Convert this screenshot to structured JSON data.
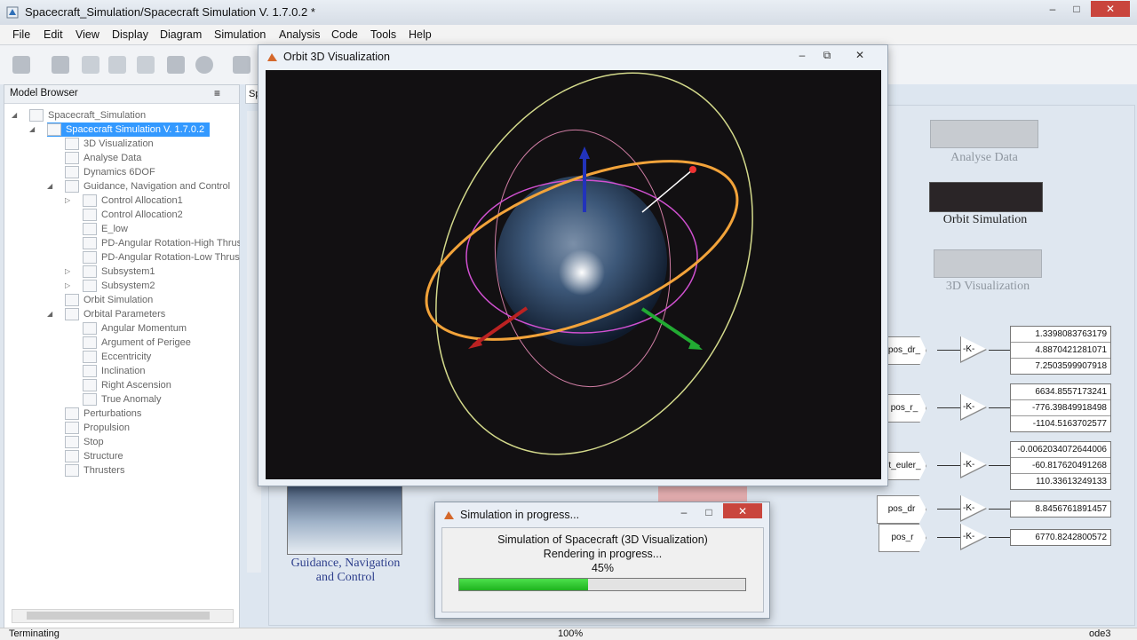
{
  "window": {
    "title": "Spacecraft_Simulation/Spacecraft Simulation V. 1.7.0.2 *",
    "controls": {
      "minimize": "–",
      "maximize": "□",
      "close": "✕"
    }
  },
  "menu": [
    "File",
    "Edit",
    "View",
    "Display",
    "Diagram",
    "Simulation",
    "Analysis",
    "Code",
    "Tools",
    "Help"
  ],
  "model_browser": {
    "title": "Model Browser",
    "menu_icon": "≡",
    "tree": [
      {
        "label": "Spacecraft_Simulation",
        "expander": "◢"
      },
      {
        "label": "Spacecraft Simulation V. 1.7.0.2",
        "expander": "◢",
        "selected": true
      },
      {
        "label": "3D Visualization"
      },
      {
        "label": "Analyse Data"
      },
      {
        "label": "Dynamics 6DOF"
      },
      {
        "label": "Guidance, Navigation and Control",
        "expander": "◢"
      },
      {
        "label": "Control Allocation1",
        "expander": "▷"
      },
      {
        "label": "Control Allocation2"
      },
      {
        "label": "E_low"
      },
      {
        "label": "PD-Angular Rotation-High Thrus"
      },
      {
        "label": "PD-Angular Rotation-Low Thrus"
      },
      {
        "label": "Subsystem1",
        "expander": "▷"
      },
      {
        "label": "Subsystem2",
        "expander": "▷"
      },
      {
        "label": "Orbit Simulation"
      },
      {
        "label": "Orbital Parameters",
        "expander": "◢"
      },
      {
        "label": "Angular Momentum"
      },
      {
        "label": "Argument of Perigee"
      },
      {
        "label": "Eccentricity"
      },
      {
        "label": "Inclination"
      },
      {
        "label": "Right Ascension"
      },
      {
        "label": "True Anomaly"
      },
      {
        "label": "Perturbations"
      },
      {
        "label": "Propulsion"
      },
      {
        "label": "Stop"
      },
      {
        "label": "Structure"
      },
      {
        "label": "Thrusters"
      }
    ]
  },
  "diagram": {
    "tab_label": "Sp",
    "blocks": {
      "analyse": "Analyse Data",
      "orbit": "Orbit Simulation",
      "viz": "3D Visualization",
      "gnc": "Guidance, Navigation\nand Control"
    },
    "gain_label": "-K-",
    "signals": [
      {
        "inport": "pos_dr_",
        "values": [
          "1.3398083763179",
          "4.8870421281071",
          "7.2503599907918"
        ]
      },
      {
        "inport": "pos_r_",
        "values": [
          "6634.8557173241",
          "-776.39849918498",
          "-1104.5163702577"
        ]
      },
      {
        "inport": "ct_euler_",
        "values": [
          "-0.0062034072644006",
          "-60.817620491268",
          "110.33613249133"
        ]
      },
      {
        "inport": "pos_dr",
        "values": [
          "8.8456761891457"
        ]
      },
      {
        "inport": "pos_r",
        "values": [
          "6770.8242800572"
        ]
      }
    ]
  },
  "orbit_window": {
    "title": "Orbit 3D Visualization",
    "controls": {
      "minimize": "–",
      "restore": "⧉",
      "close": "✕"
    }
  },
  "progress_dialog": {
    "title": "Simulation in progress...",
    "line1": "Simulation of Spacecraft (3D Visualization)",
    "line2": "Rendering in progress...",
    "percent_text": "45%",
    "progress": 0.45,
    "controls": {
      "minimize": "–",
      "maximize": "□",
      "close": "✕"
    }
  },
  "status_bar": {
    "left": "Terminating",
    "zoom": "100%",
    "solver": "ode3"
  },
  "colors": {
    "selection": "#3399ff",
    "progress_fill": "#22c322",
    "close_red": "#c9453d"
  }
}
